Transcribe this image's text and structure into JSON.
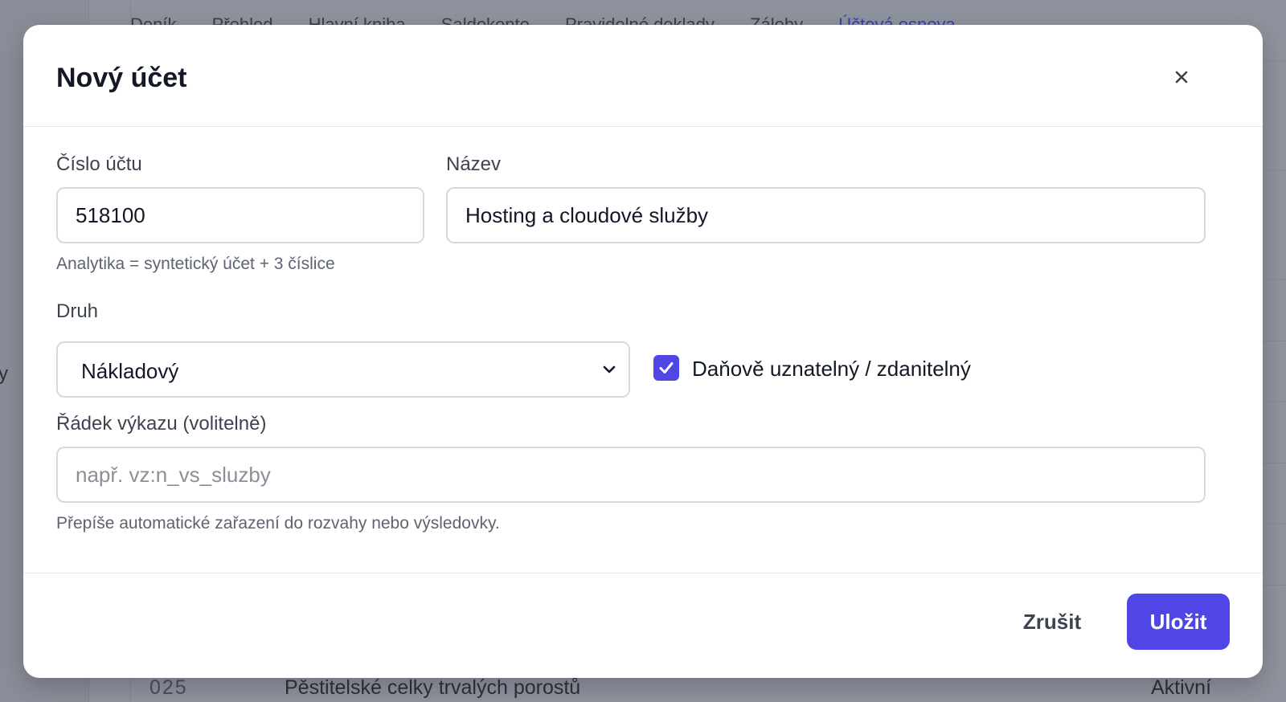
{
  "background": {
    "nav_items": [
      "Deník",
      "Přehled",
      "Hlavní kniha",
      "Saldokonto",
      "Pravidelné doklady",
      "Zálohy",
      "Účtová osnova"
    ],
    "nav_active_index": 6,
    "sidebar_stub": "y",
    "row": {
      "code": "025",
      "name": "Pěstitelské celky trvalých porostů",
      "status": "Aktivní"
    }
  },
  "modal": {
    "title": "Nový účet",
    "close_icon": "close-icon",
    "account_number": {
      "label": "Číslo účtu",
      "value": "518100",
      "hint": "Analytika = syntetický účet + 3 číslice"
    },
    "name": {
      "label": "Název",
      "value": "Hosting a cloudové služby"
    },
    "type": {
      "label": "Druh",
      "selected": "Nákladový"
    },
    "tax_deductible": {
      "label": "Daňově uznatelný / zdanitelný",
      "checked": true
    },
    "report_line": {
      "label": "Řádek výkazu (volitelně)",
      "value": "",
      "placeholder": "např. vz:n_vs_sluzby",
      "hint": "Přepíše automatické zařazení do rozvahy nebo výsledovky."
    },
    "footer": {
      "cancel_label": "Zrušit",
      "save_label": "Uložit"
    }
  },
  "colors": {
    "accent": "#4f46e5",
    "overlay": "#8f939d",
    "text": "#121826"
  }
}
